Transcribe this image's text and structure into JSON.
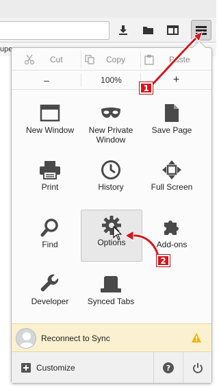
{
  "bookmarks_bar": {
    "partial_text": "upe"
  },
  "menu": {
    "edit": {
      "cut": "Cut",
      "copy": "Copy",
      "paste": "Paste"
    },
    "zoom": {
      "minus": "–",
      "level": "100%",
      "plus": "+"
    },
    "tiles": [
      {
        "label": "New Window",
        "icon": "window-icon"
      },
      {
        "label": "New Private Window",
        "icon": "mask-icon"
      },
      {
        "label": "Save Page",
        "icon": "page-icon"
      },
      {
        "label": "Print",
        "icon": "printer-icon"
      },
      {
        "label": "History",
        "icon": "clock-icon"
      },
      {
        "label": "Full Screen",
        "icon": "fullscreen-icon"
      },
      {
        "label": "Find",
        "icon": "magnifier-icon"
      },
      {
        "label": "Options",
        "icon": "gear-icon"
      },
      {
        "label": "Add-ons",
        "icon": "puzzle-icon"
      },
      {
        "label": "Developer",
        "icon": "wrench-icon"
      },
      {
        "label": "Synced Tabs",
        "icon": "synced-tabs-icon"
      }
    ],
    "sync": {
      "label": "Reconnect to Sync"
    },
    "footer": {
      "customize": "Customize"
    }
  },
  "callouts": {
    "first": "1",
    "second": "2"
  },
  "colors": {
    "callout": "#d8161c",
    "sync_bg": "#fbf0cf",
    "warning": "#f0b400"
  }
}
